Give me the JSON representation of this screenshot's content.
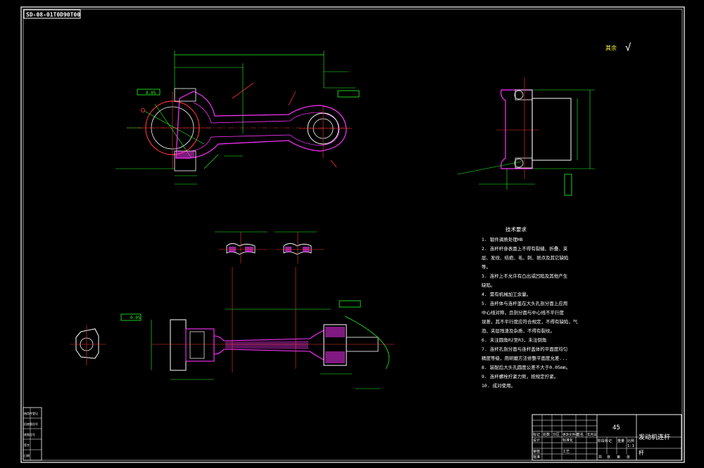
{
  "drawing_number": "SD-08-01T0D90T00",
  "finish_mark": "其余",
  "tech_requirements": {
    "title": "技术要求",
    "items": [
      "1. 锻件调质处理HB",
      "2. 连杆杆身表面上不得有裂缝、折叠、夹",
      "层、发纹、结疤、毛、刺、斑点及其它缺陷",
      "等。",
      "3. 连杆上不允许有凸出或凹陷及其他产生",
      "缺陷。",
      "4. 需有机械加工余量。",
      "5. 连杆体与连杆盖在大头孔剖分面上应用",
      "中心线对称，且剖分面与中心线不平行度",
      "误差，其不平行度应符合规定，不得有缺陷，气",
      "泡、夹层残渣及杂质，不得有裂纹。",
      "6. 未注圆角R2至R3，未注倒角",
      "7. 连杆孔剖分面与连杆盖体的平面度均匀",
      "精度等级，用研磨方法修整平面度允差...",
      "8. 装配后大头孔圆度公差不大于0.05mm。",
      "9. 连杆螺栓拧紧力矩，按规定拧紧。",
      "10. 成对使用。"
    ]
  },
  "title_block": {
    "material": "45",
    "part_name": "发动机连杆",
    "part_name_2": "杆",
    "scale": "1:1",
    "row_labels": [
      "标记",
      "处数",
      "分区",
      "更改文件号",
      "签名",
      "年月日"
    ],
    "row2_labels": [
      "设计",
      "标准化",
      "阶段标记",
      "重量",
      "比例"
    ],
    "row3_labels": [
      "审核",
      "工艺",
      "批准",
      "共",
      "张",
      "第",
      "张"
    ]
  },
  "left_strip": {
    "cells": [
      "借用件登记",
      "旧底图总号",
      "底图总号",
      "签字",
      "日期"
    ]
  },
  "annotations": {
    "flatness": "0.05",
    "parallel": "0.05",
    "ra_symbol": "√"
  }
}
